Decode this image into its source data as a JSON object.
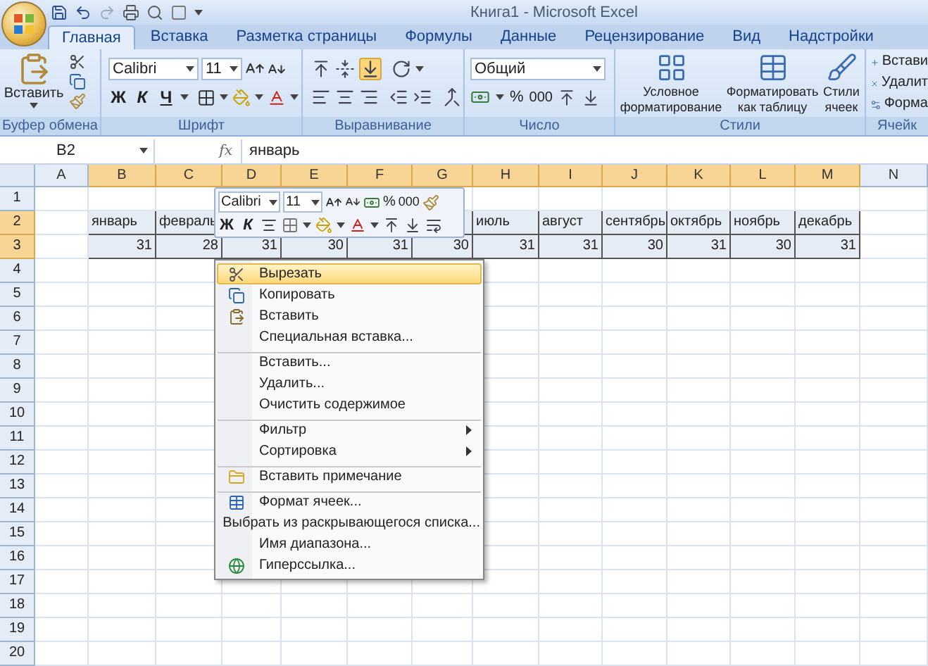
{
  "window": {
    "title": "Книга1 - Microsoft Excel"
  },
  "tabs": [
    {
      "label": "Главная",
      "selected": true
    },
    {
      "label": "Вставка",
      "selected": false
    },
    {
      "label": "Разметка страницы",
      "selected": false
    },
    {
      "label": "Формулы",
      "selected": false
    },
    {
      "label": "Данные",
      "selected": false
    },
    {
      "label": "Рецензирование",
      "selected": false
    },
    {
      "label": "Вид",
      "selected": false
    },
    {
      "label": "Надстройки",
      "selected": false
    }
  ],
  "ribbon": {
    "clipboard": {
      "paste": "Вставить",
      "label": "Буфер обмена"
    },
    "font": {
      "name": "Calibri",
      "size": "11",
      "bold": "Ж",
      "italic": "К",
      "underline": "Ч",
      "label": "Шрифт"
    },
    "alignment": {
      "bottom_align": {
        "on": true
      },
      "label": "Выравнивание"
    },
    "number": {
      "format": "Общий",
      "percent": "%",
      "thousands": "000",
      "label": "Число"
    },
    "styles": {
      "buttons": [
        "Условное форматирование",
        "Форматировать как таблицу",
        "Стили ячеек"
      ],
      "label": "Стили"
    },
    "cells": {
      "buttons": [
        "Встави",
        "Удалит",
        "Форма"
      ],
      "label": "Ячейк"
    }
  },
  "formula_bar": {
    "name_box": "B2",
    "function_label": "fx",
    "value": "январь"
  },
  "sheet": {
    "columns": [
      {
        "label": "A",
        "selected": false
      },
      {
        "label": "B",
        "selected": true
      },
      {
        "label": "C",
        "selected": true
      },
      {
        "label": "D",
        "selected": true
      },
      {
        "label": "E",
        "selected": true
      },
      {
        "label": "F",
        "selected": true
      },
      {
        "label": "G",
        "selected": true
      },
      {
        "label": "H",
        "selected": true
      },
      {
        "label": "I",
        "selected": true
      },
      {
        "label": "J",
        "selected": true
      },
      {
        "label": "K",
        "selected": true
      },
      {
        "label": "L",
        "selected": true
      },
      {
        "label": "M",
        "selected": true
      },
      {
        "label": "N",
        "selected": false
      }
    ],
    "rows": [
      {
        "number": "1",
        "selected": false
      },
      {
        "number": "2",
        "selected": true,
        "cells": [
          null,
          "январь",
          "февраль",
          null,
          null,
          null,
          null,
          "июль",
          "август",
          "сентябрь",
          "октябрь",
          "ноябрь",
          "декабрь",
          null
        ]
      },
      {
        "number": "3",
        "selected": true,
        "cells": [
          null,
          "31",
          "28",
          "31",
          "30",
          "31",
          "30",
          "31",
          "31",
          "30",
          "31",
          "30",
          "31",
          null
        ]
      },
      {
        "number": "4",
        "selected": false
      },
      {
        "number": "5",
        "selected": false
      },
      {
        "number": "6",
        "selected": false
      },
      {
        "number": "7",
        "selected": false
      },
      {
        "number": "8",
        "selected": false
      },
      {
        "number": "9",
        "selected": false
      },
      {
        "number": "10",
        "selected": false
      },
      {
        "number": "11",
        "selected": false
      },
      {
        "number": "12",
        "selected": false
      },
      {
        "number": "13",
        "selected": false
      },
      {
        "number": "14",
        "selected": false
      },
      {
        "number": "15",
        "selected": false
      },
      {
        "number": "16",
        "selected": false
      },
      {
        "number": "17",
        "selected": false
      },
      {
        "number": "18",
        "selected": false
      },
      {
        "number": "19",
        "selected": false
      },
      {
        "number": "20",
        "selected": false
      }
    ]
  },
  "mini_toolbar": {
    "font": "Calibri",
    "size": "11",
    "percent": "%",
    "thousands": "000",
    "bold": "Ж",
    "italic": "К"
  },
  "context_menu": {
    "items": [
      {
        "label": "Вырезать",
        "selected": true,
        "submenu": false,
        "divider_before": false
      },
      {
        "label": "Копировать",
        "selected": false,
        "submenu": false,
        "divider_before": false
      },
      {
        "label": "Вставить",
        "selected": false,
        "submenu": false,
        "divider_before": false
      },
      {
        "label": "Специальная вставка...",
        "selected": false,
        "submenu": false,
        "divider_before": false
      },
      {
        "label": "Вставить...",
        "selected": false,
        "submenu": false,
        "divider_before": true
      },
      {
        "label": "Удалить...",
        "selected": false,
        "submenu": false,
        "divider_before": false
      },
      {
        "label": "Очистить содержимое",
        "selected": false,
        "submenu": false,
        "divider_before": false
      },
      {
        "label": "Фильтр",
        "selected": false,
        "submenu": true,
        "divider_before": true
      },
      {
        "label": "Сортировка",
        "selected": false,
        "submenu": true,
        "divider_before": false
      },
      {
        "label": "Вставить примечание",
        "selected": false,
        "submenu": false,
        "divider_before": true
      },
      {
        "label": "Формат ячеек...",
        "selected": false,
        "submenu": false,
        "divider_before": true
      },
      {
        "label": "Выбрать из раскрывающегося списка...",
        "selected": false,
        "submenu": false,
        "divider_before": false
      },
      {
        "label": "Имя диапазона...",
        "selected": false,
        "submenu": false,
        "divider_before": false
      },
      {
        "label": "Гиперссылка...",
        "selected": false,
        "submenu": false,
        "divider_before": false
      }
    ]
  }
}
